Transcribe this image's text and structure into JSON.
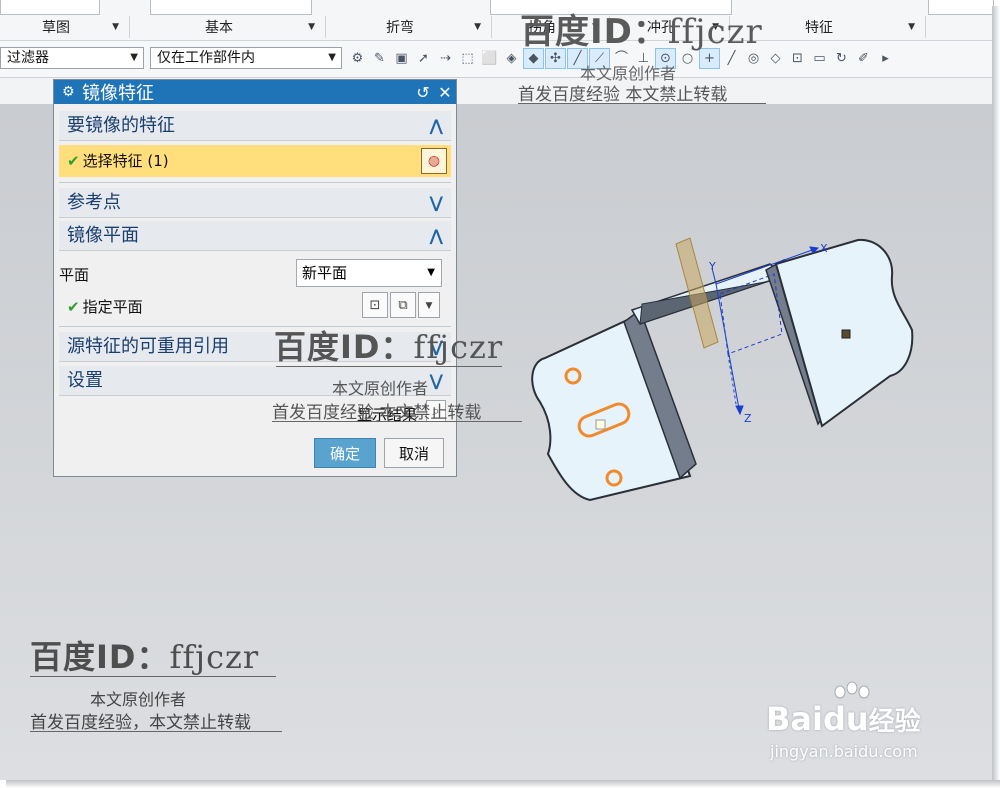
{
  "ribbon": {
    "groups": [
      {
        "label": "草图",
        "has_dropdown": true
      },
      {
        "label": "基本",
        "has_dropdown": true
      },
      {
        "label": "折弯",
        "has_dropdown": true
      },
      {
        "label": "拐角",
        "has_dropdown": true
      },
      {
        "label": "冲孔",
        "has_dropdown": true
      },
      {
        "label": "特征",
        "has_dropdown": true
      }
    ]
  },
  "toolbar": {
    "filter_combo": "过滤器",
    "scope_combo": "仅在工作部件内"
  },
  "dialog": {
    "title": "镜像特征",
    "reset_icon": "↺",
    "close_icon": "✕",
    "sections": {
      "features": "要镜像的特征",
      "reference_point": "参考点",
      "mirror_plane": "镜像平面",
      "reusable_refs": "源特征的可重用引用",
      "settings": "设置"
    },
    "select_feature": "选择特征 (1)",
    "plane_label": "平面",
    "plane_value": "新平面",
    "specify_plane": "指定平面",
    "show_result": "显示结果",
    "ok": "确定",
    "cancel": "取消"
  },
  "viewport": {
    "axes": {
      "x": "X",
      "y": "Y",
      "z": "Z"
    }
  },
  "watermarks": {
    "id_main": "百度ID：",
    "id_handle": "ffjczr",
    "line1": "本文原创作者",
    "line2": "首发百度经验，本文禁止转载",
    "line2_short": "首发百度经验  本文禁止转载",
    "baidu_logo": "Bai",
    "baidu_du": "du",
    "baidu_jy": "经验",
    "baidu_url": "jingyan.baidu.com"
  },
  "colors": {
    "dialog_title": "#1f74b8",
    "selection_highlight": "#ffde7b",
    "ok_button": "#5aa3cf",
    "part_fill": "#e6f3fb",
    "part_edge": "#2a2f38",
    "hole_orange": "#f08a2c",
    "plane_tan": "#c8a860"
  }
}
